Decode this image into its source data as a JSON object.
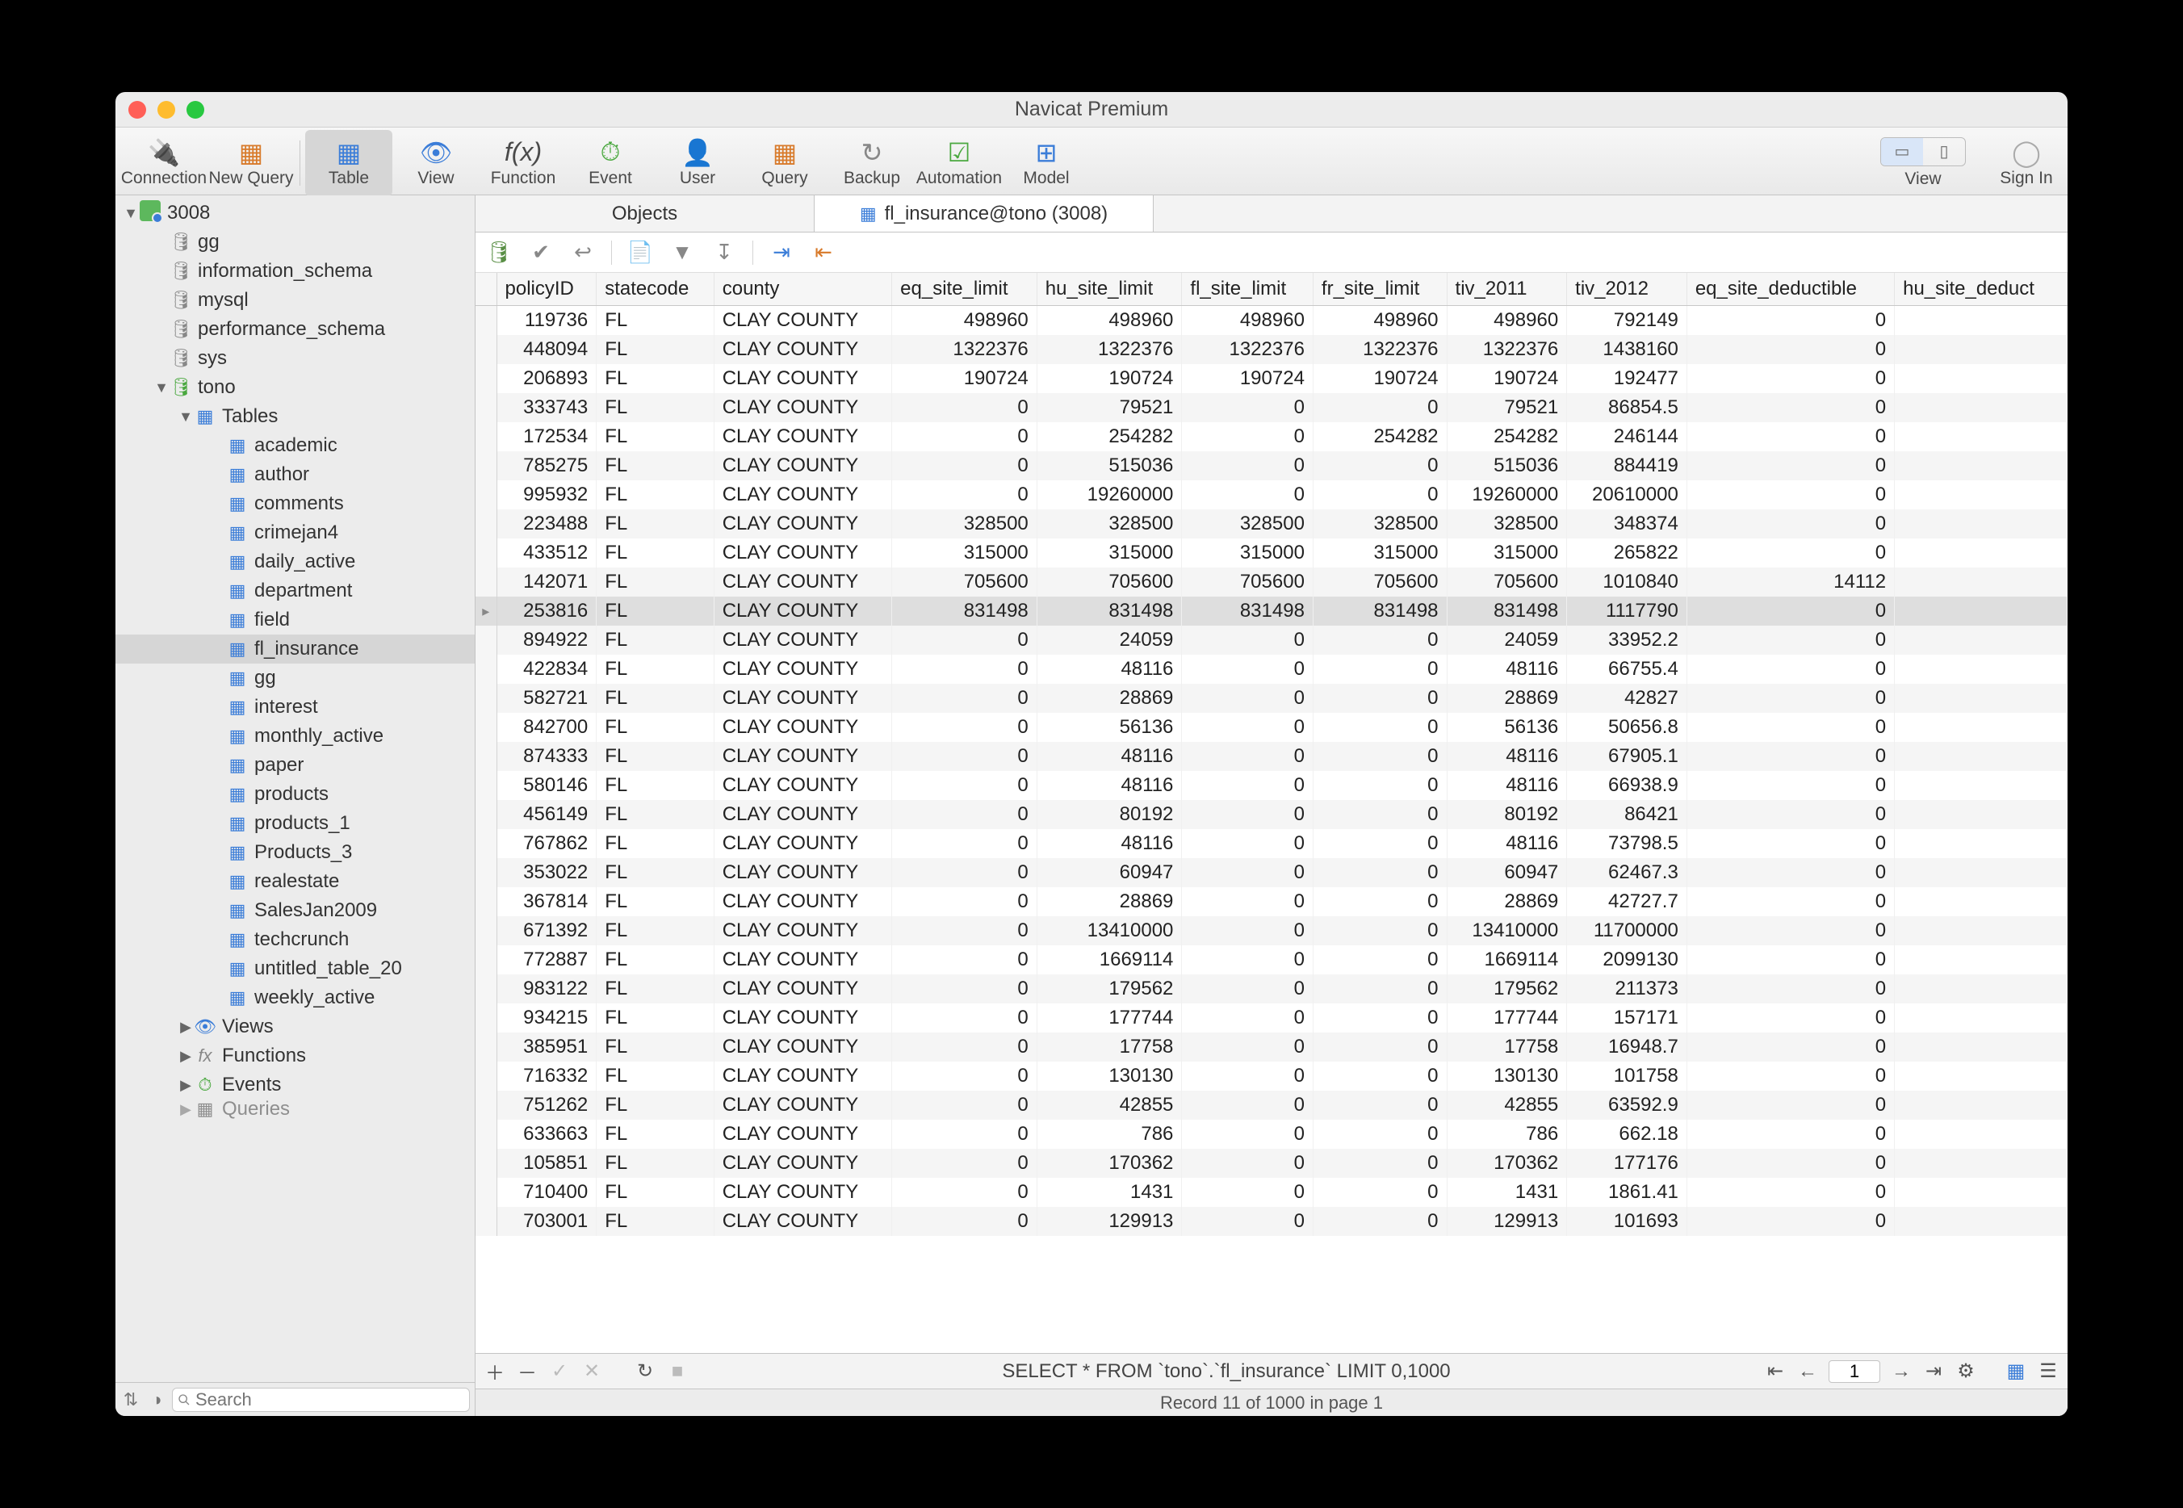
{
  "window": {
    "title": "Navicat Premium"
  },
  "toolbar": {
    "connection": "Connection",
    "newquery": "New Query",
    "table": "Table",
    "view": "View",
    "function": "Function",
    "event": "Event",
    "user": "User",
    "query": "Query",
    "backup": "Backup",
    "automation": "Automation",
    "model": "Model",
    "viewlabel": "View",
    "signin": "Sign In"
  },
  "tabs": {
    "objects": "Objects",
    "active": "fl_insurance@tono (3008)"
  },
  "sidebar": {
    "connection": "3008",
    "dbs": [
      "gg",
      "information_schema",
      "mysql",
      "performance_schema",
      "sys"
    ],
    "activedb": "tono",
    "tableslabel": "Tables",
    "tables": [
      "academic",
      "author",
      "comments",
      "crimejan4",
      "daily_active",
      "department",
      "field",
      "fl_insurance",
      "gg",
      "interest",
      "monthly_active",
      "paper",
      "products",
      "products_1",
      "Products_3",
      "realestate",
      "SalesJan2009",
      "techcrunch",
      "untitled_table_20",
      "weekly_active"
    ],
    "selected_table": "fl_insurance",
    "views": "Views",
    "functions": "Functions",
    "events": "Events",
    "queries": "Queries",
    "search_placeholder": "Search"
  },
  "columns": [
    "policyID",
    "statecode",
    "county",
    "eq_site_limit",
    "hu_site_limit",
    "fl_site_limit",
    "fr_site_limit",
    "tiv_2011",
    "tiv_2012",
    "eq_site_deductible",
    "hu_site_deduct"
  ],
  "rows": [
    [
      "119736",
      "FL",
      "CLAY COUNTY",
      "498960",
      "498960",
      "498960",
      "498960",
      "498960",
      "792149",
      "0",
      ""
    ],
    [
      "448094",
      "FL",
      "CLAY COUNTY",
      "1322376",
      "1322376",
      "1322376",
      "1322376",
      "1322376",
      "1438160",
      "0",
      ""
    ],
    [
      "206893",
      "FL",
      "CLAY COUNTY",
      "190724",
      "190724",
      "190724",
      "190724",
      "190724",
      "192477",
      "0",
      ""
    ],
    [
      "333743",
      "FL",
      "CLAY COUNTY",
      "0",
      "79521",
      "0",
      "0",
      "79521",
      "86854.5",
      "0",
      ""
    ],
    [
      "172534",
      "FL",
      "CLAY COUNTY",
      "0",
      "254282",
      "0",
      "254282",
      "254282",
      "246144",
      "0",
      ""
    ],
    [
      "785275",
      "FL",
      "CLAY COUNTY",
      "0",
      "515036",
      "0",
      "0",
      "515036",
      "884419",
      "0",
      ""
    ],
    [
      "995932",
      "FL",
      "CLAY COUNTY",
      "0",
      "19260000",
      "0",
      "0",
      "19260000",
      "20610000",
      "0",
      ""
    ],
    [
      "223488",
      "FL",
      "CLAY COUNTY",
      "328500",
      "328500",
      "328500",
      "328500",
      "328500",
      "348374",
      "0",
      ""
    ],
    [
      "433512",
      "FL",
      "CLAY COUNTY",
      "315000",
      "315000",
      "315000",
      "315000",
      "315000",
      "265822",
      "0",
      ""
    ],
    [
      "142071",
      "FL",
      "CLAY COUNTY",
      "705600",
      "705600",
      "705600",
      "705600",
      "705600",
      "1010840",
      "14112",
      ""
    ],
    [
      "253816",
      "FL",
      "CLAY COUNTY",
      "831498",
      "831498",
      "831498",
      "831498",
      "831498",
      "1117790",
      "0",
      ""
    ],
    [
      "894922",
      "FL",
      "CLAY COUNTY",
      "0",
      "24059",
      "0",
      "0",
      "24059",
      "33952.2",
      "0",
      ""
    ],
    [
      "422834",
      "FL",
      "CLAY COUNTY",
      "0",
      "48116",
      "0",
      "0",
      "48116",
      "66755.4",
      "0",
      ""
    ],
    [
      "582721",
      "FL",
      "CLAY COUNTY",
      "0",
      "28869",
      "0",
      "0",
      "28869",
      "42827",
      "0",
      ""
    ],
    [
      "842700",
      "FL",
      "CLAY COUNTY",
      "0",
      "56136",
      "0",
      "0",
      "56136",
      "50656.8",
      "0",
      ""
    ],
    [
      "874333",
      "FL",
      "CLAY COUNTY",
      "0",
      "48116",
      "0",
      "0",
      "48116",
      "67905.1",
      "0",
      ""
    ],
    [
      "580146",
      "FL",
      "CLAY COUNTY",
      "0",
      "48116",
      "0",
      "0",
      "48116",
      "66938.9",
      "0",
      ""
    ],
    [
      "456149",
      "FL",
      "CLAY COUNTY",
      "0",
      "80192",
      "0",
      "0",
      "80192",
      "86421",
      "0",
      ""
    ],
    [
      "767862",
      "FL",
      "CLAY COUNTY",
      "0",
      "48116",
      "0",
      "0",
      "48116",
      "73798.5",
      "0",
      ""
    ],
    [
      "353022",
      "FL",
      "CLAY COUNTY",
      "0",
      "60947",
      "0",
      "0",
      "60947",
      "62467.3",
      "0",
      ""
    ],
    [
      "367814",
      "FL",
      "CLAY COUNTY",
      "0",
      "28869",
      "0",
      "0",
      "28869",
      "42727.7",
      "0",
      ""
    ],
    [
      "671392",
      "FL",
      "CLAY COUNTY",
      "0",
      "13410000",
      "0",
      "0",
      "13410000",
      "11700000",
      "0",
      ""
    ],
    [
      "772887",
      "FL",
      "CLAY COUNTY",
      "0",
      "1669114",
      "0",
      "0",
      "1669114",
      "2099130",
      "0",
      ""
    ],
    [
      "983122",
      "FL",
      "CLAY COUNTY",
      "0",
      "179562",
      "0",
      "0",
      "179562",
      "211373",
      "0",
      ""
    ],
    [
      "934215",
      "FL",
      "CLAY COUNTY",
      "0",
      "177744",
      "0",
      "0",
      "177744",
      "157171",
      "0",
      ""
    ],
    [
      "385951",
      "FL",
      "CLAY COUNTY",
      "0",
      "17758",
      "0",
      "0",
      "17758",
      "16948.7",
      "0",
      ""
    ],
    [
      "716332",
      "FL",
      "CLAY COUNTY",
      "0",
      "130130",
      "0",
      "0",
      "130130",
      "101758",
      "0",
      ""
    ],
    [
      "751262",
      "FL",
      "CLAY COUNTY",
      "0",
      "42855",
      "0",
      "0",
      "42855",
      "63592.9",
      "0",
      ""
    ],
    [
      "633663",
      "FL",
      "CLAY COUNTY",
      "0",
      "786",
      "0",
      "0",
      "786",
      "662.18",
      "0",
      ""
    ],
    [
      "105851",
      "FL",
      "CLAY COUNTY",
      "0",
      "170362",
      "0",
      "0",
      "170362",
      "177176",
      "0",
      ""
    ],
    [
      "710400",
      "FL",
      "CLAY COUNTY",
      "0",
      "1431",
      "0",
      "0",
      "1431",
      "1861.41",
      "0",
      ""
    ],
    [
      "703001",
      "FL",
      "CLAY COUNTY",
      "0",
      "129913",
      "0",
      "0",
      "129913",
      "101693",
      "0",
      ""
    ]
  ],
  "current_row_index": 10,
  "col_align": [
    "r",
    "l",
    "l",
    "r",
    "r",
    "r",
    "r",
    "r",
    "r",
    "r",
    "l"
  ],
  "footer": {
    "sql": "SELECT * FROM `tono`.`fl_insurance` LIMIT 0,1000",
    "page": "1"
  },
  "statusbar": "Record 11 of 1000 in page 1"
}
